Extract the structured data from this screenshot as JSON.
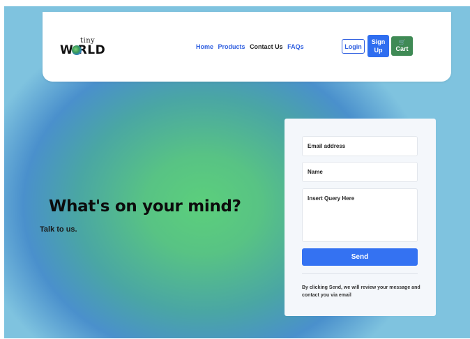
{
  "nav": {
    "logo_tiny": "tiny",
    "logo_world": "W RLD",
    "links": [
      "Home",
      "Products",
      "Contact Us",
      "FAQs"
    ],
    "login": "Login",
    "signup": "Sign Up",
    "cart": "Cart",
    "cart_icon": "cart-icon"
  },
  "hero": {
    "headline": "What's on your mind?",
    "subline": "Talk to us."
  },
  "form": {
    "email_placeholder": "Email address",
    "name_placeholder": "Name",
    "query_placeholder": "Insert Query Here",
    "send_label": "Send",
    "note": "By clicking Send, we will review your message and contact you via email"
  },
  "colors": {
    "primary": "#2f6ef0",
    "cart_green": "#3f8a55"
  }
}
